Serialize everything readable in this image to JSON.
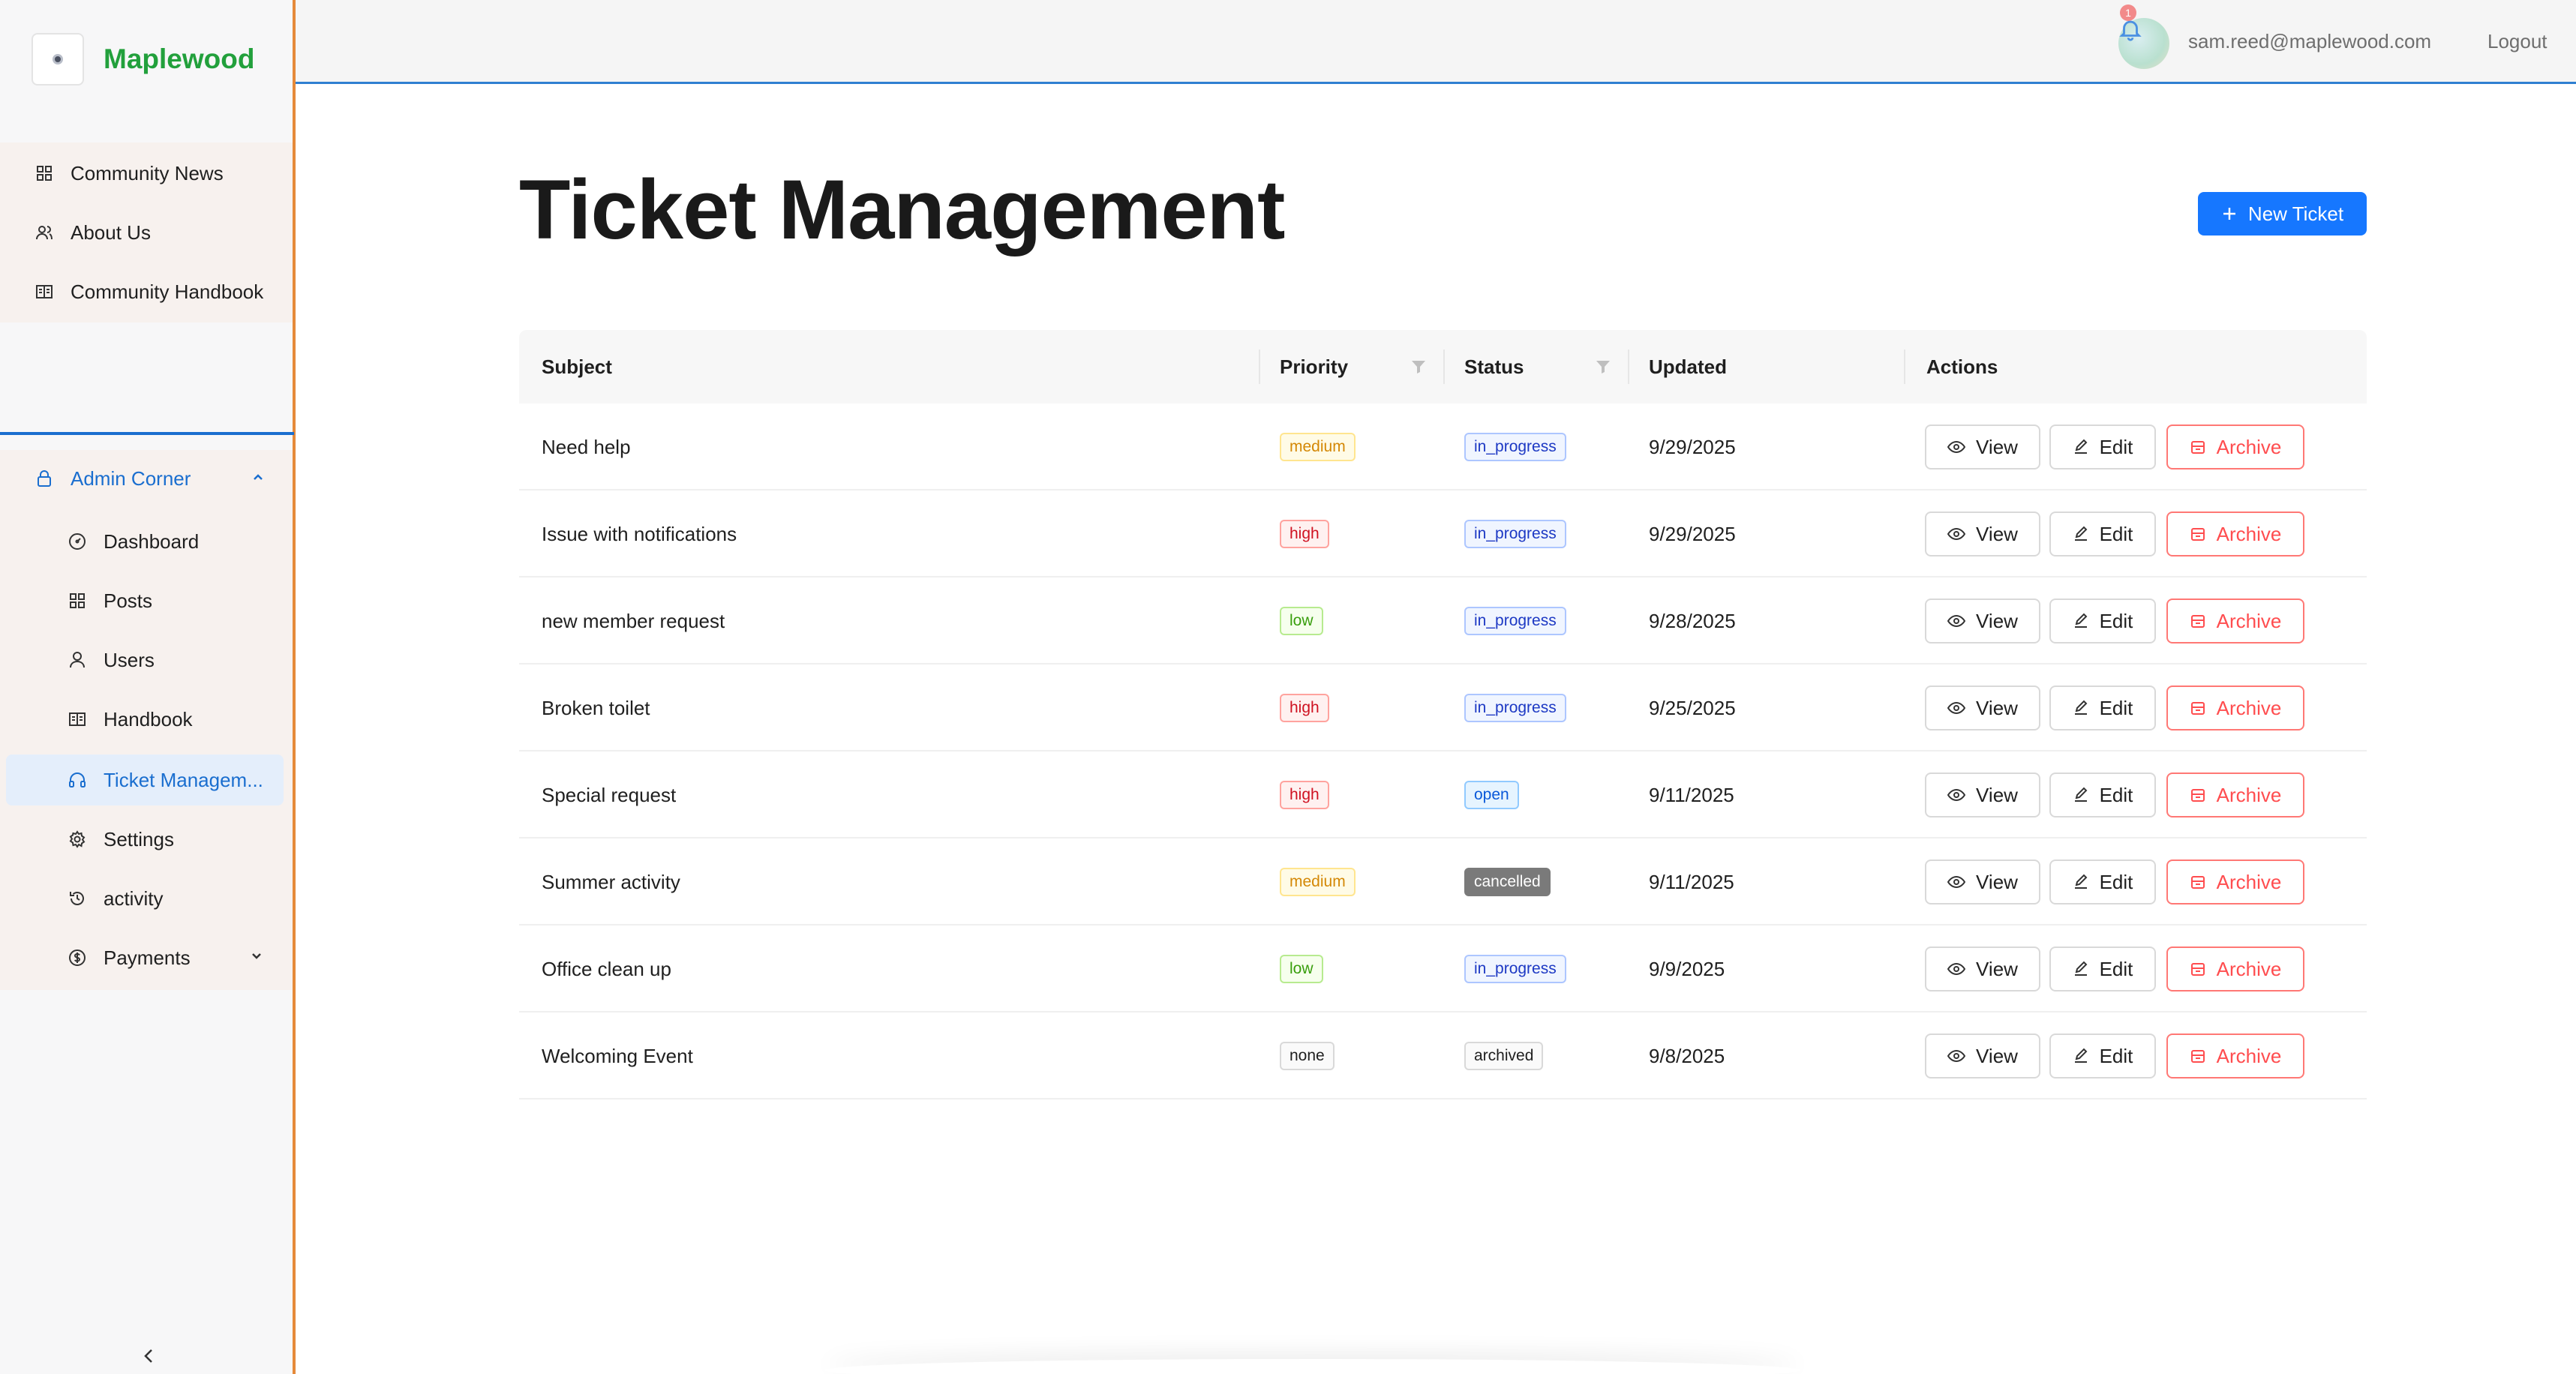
{
  "brand": {
    "name": "Maplewood"
  },
  "sidebar": {
    "top_items": [
      {
        "label": "Community News",
        "icon": "grid-icon"
      },
      {
        "label": "About Us",
        "icon": "users-icon"
      },
      {
        "label": "Community Handbook",
        "icon": "book-icon"
      }
    ],
    "admin": {
      "label": "Admin Corner",
      "icon": "lock-icon",
      "items": [
        {
          "label": "Dashboard",
          "icon": "dashboard-icon"
        },
        {
          "label": "Posts",
          "icon": "grid-icon"
        },
        {
          "label": "Users",
          "icon": "user-icon"
        },
        {
          "label": "Handbook",
          "icon": "book-icon"
        },
        {
          "label": "Ticket Managem...",
          "icon": "headset-icon",
          "active": true
        },
        {
          "label": "Settings",
          "icon": "gear-icon"
        },
        {
          "label": "activity",
          "icon": "history-icon"
        },
        {
          "label": "Payments",
          "icon": "dollar-icon"
        }
      ]
    }
  },
  "header": {
    "notification_count": "1",
    "user_email": "sam.reed@maplewood.com",
    "logout_label": "Logout"
  },
  "main": {
    "title": "Ticket Management",
    "new_ticket_label": "New Ticket",
    "columns": [
      "Subject",
      "Priority",
      "Status",
      "Updated",
      "Actions"
    ],
    "action_labels": {
      "view": "View",
      "edit": "Edit",
      "archive": "Archive"
    },
    "rows": [
      {
        "subject": "Need help",
        "priority": "medium",
        "status": "in_progress",
        "updated": "9/29/2025"
      },
      {
        "subject": "Issue with notifications",
        "priority": "high",
        "status": "in_progress",
        "updated": "9/29/2025"
      },
      {
        "subject": "new member request",
        "priority": "low",
        "status": "in_progress",
        "updated": "9/28/2025"
      },
      {
        "subject": "Broken toilet",
        "priority": "high",
        "status": "in_progress",
        "updated": "9/25/2025"
      },
      {
        "subject": "Special request",
        "priority": "high",
        "status": "open",
        "updated": "9/11/2025"
      },
      {
        "subject": "Summer activity",
        "priority": "medium",
        "status": "cancelled",
        "updated": "9/11/2025"
      },
      {
        "subject": "Office clean up",
        "priority": "low",
        "status": "in_progress",
        "updated": "9/9/2025"
      },
      {
        "subject": "Welcoming Event",
        "priority": "none",
        "status": "archived",
        "updated": "9/8/2025"
      }
    ]
  },
  "colors": {
    "brand_green": "#22a03c",
    "primary_blue": "#1677ff",
    "danger_red": "#ff4d4f",
    "sidebar_accent_orange": "#e58a3a"
  }
}
